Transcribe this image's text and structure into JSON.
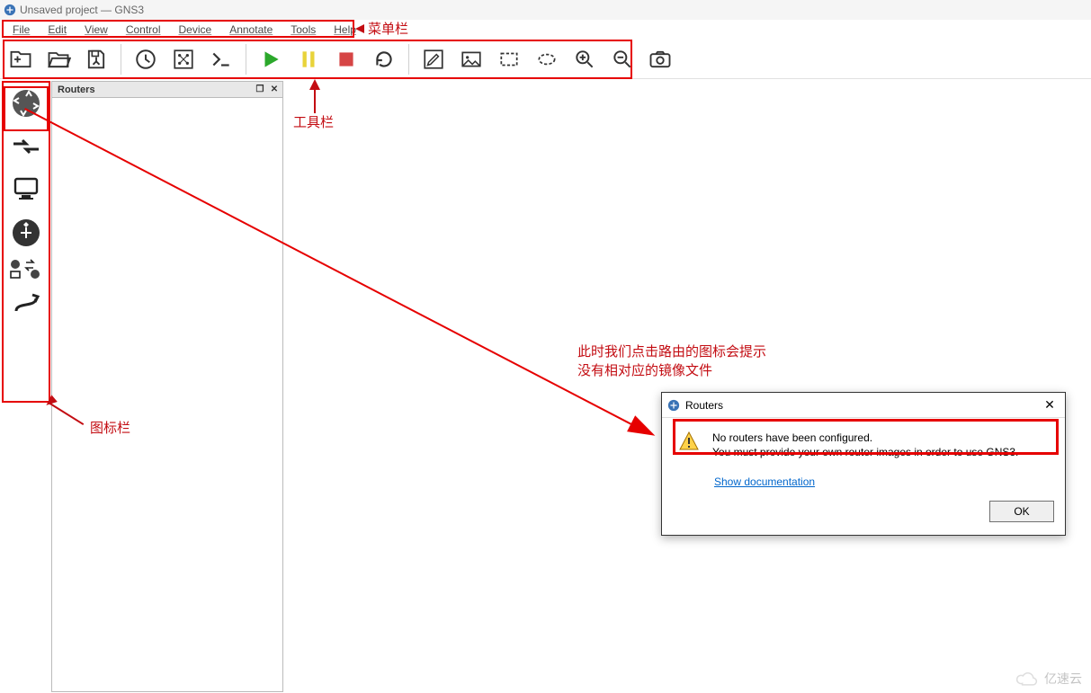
{
  "title": "Unsaved project — GNS3",
  "menu": [
    "File",
    "Edit",
    "View",
    "Control",
    "Device",
    "Annotate",
    "Tools",
    "Help"
  ],
  "panel": {
    "title": "Routers"
  },
  "dialog": {
    "title": "Routers",
    "msg1": "No routers have been configured.",
    "msg2": "You must provide your own router images in order to use GNS3.",
    "link": "Show documentation",
    "ok": "OK"
  },
  "ann": {
    "menubar": "菜单栏",
    "toolbar": "工具栏",
    "iconbar": "图标栏",
    "dialog1": "此时我们点击路由的图标会提示",
    "dialog2": "没有相对应的镜像文件"
  },
  "watermark": "亿速云",
  "colors": {
    "red": "#e60000",
    "annRed": "#c30c12"
  }
}
